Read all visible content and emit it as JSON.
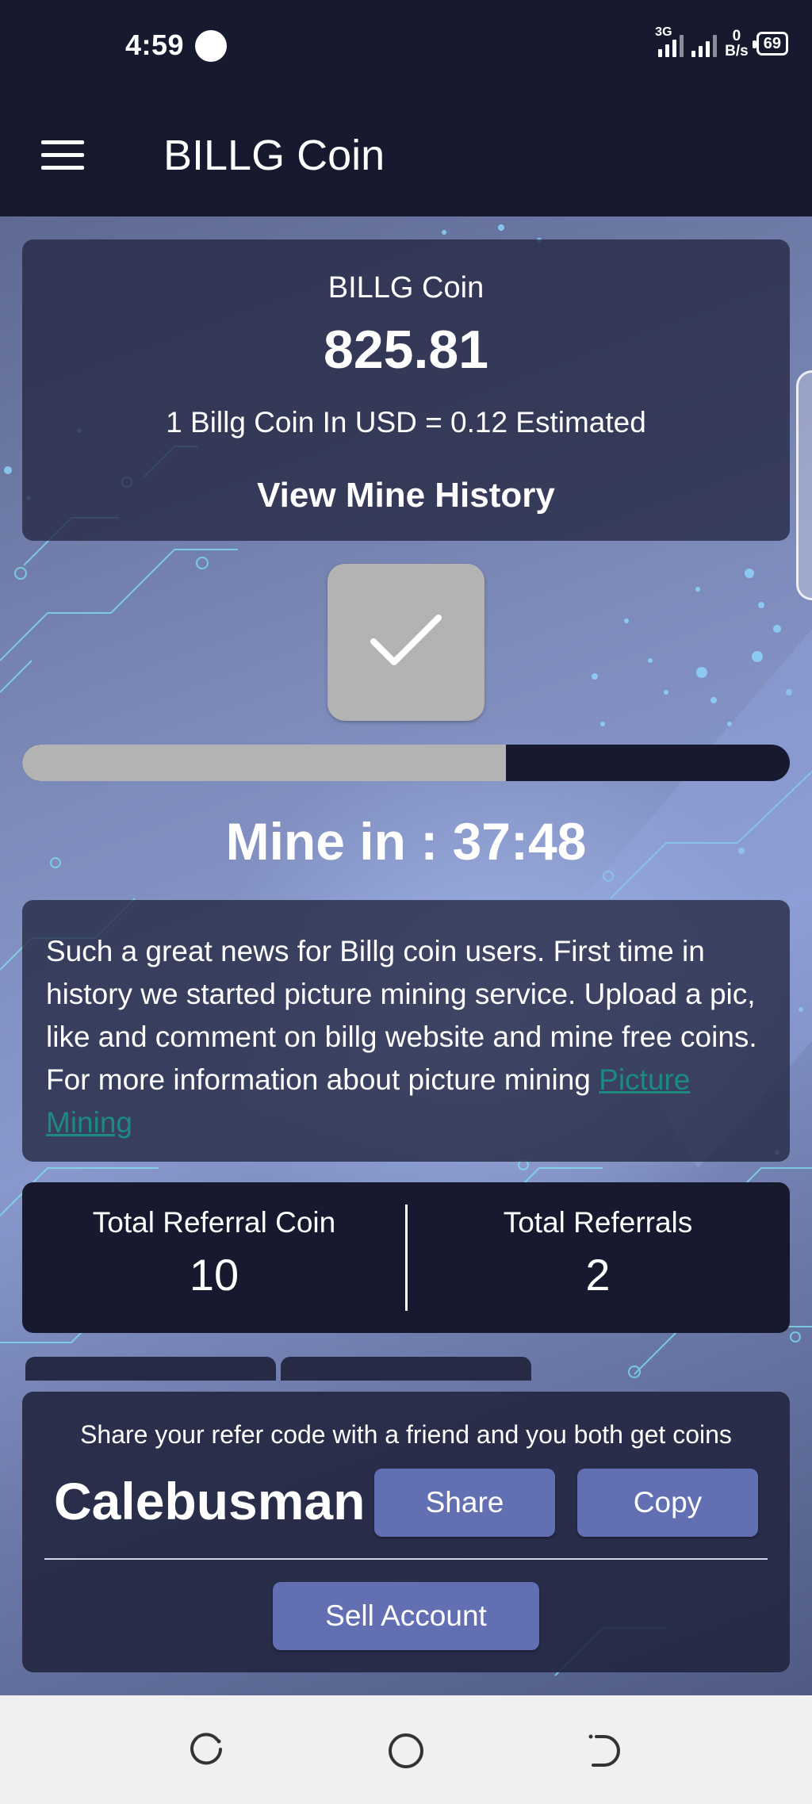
{
  "status_bar": {
    "time": "4:59",
    "network": "3G",
    "speed_value": "0",
    "speed_unit": "B/s",
    "battery": "69"
  },
  "app_bar": {
    "title": "BILLG Coin",
    "menu_icon": "hamburger-menu-icon"
  },
  "balance": {
    "label": "BILLG Coin",
    "amount": "825.81",
    "rate_text": "1 Billg Coin In USD = 0.12 Estimated",
    "history_link": "View Mine History"
  },
  "mining": {
    "button_icon": "checkmark-icon",
    "progress_fraction": 0.63,
    "countdown": "Mine in : 37:48"
  },
  "news": {
    "text": "Such a great news for Billg coin users. First time in history we started picture mining service. Upload a pic, like and comment on billg website and mine free coins. For more information about picture mining ",
    "link_text": "Picture Mining"
  },
  "referrals": {
    "coin_label": "Total Referral Coin",
    "coin_value": "10",
    "count_label": "Total Referrals",
    "count_value": "2"
  },
  "share": {
    "description": "Share your refer code with a friend and you both get coins",
    "refer_code": "Calebusman",
    "share_label": "Share",
    "copy_label": "Copy",
    "sell_label": "Sell Account"
  },
  "nav_bar": {
    "icons": [
      "recent-apps-icon",
      "home-icon",
      "back-icon"
    ]
  },
  "colors": {
    "dark_navy": "#171a2e",
    "button_blue": "#6270b3",
    "link_teal": "#1d8a82",
    "mine_button_gray": "#b3b3b3"
  }
}
